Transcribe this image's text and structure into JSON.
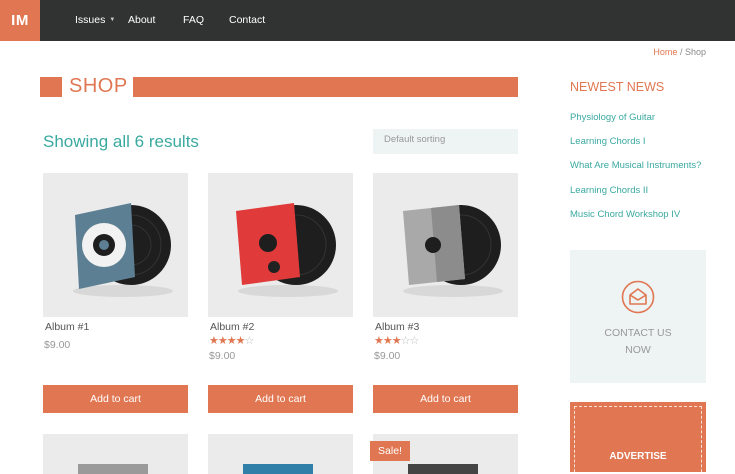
{
  "header": {
    "logo": "IM",
    "nav": [
      {
        "label": "Issues",
        "has_dropdown": true
      },
      {
        "label": "About"
      },
      {
        "label": "FAQ"
      },
      {
        "label": "Contact"
      }
    ]
  },
  "breadcrumb": {
    "home": "Home",
    "separator": "/",
    "current": "Shop"
  },
  "page_title": "SHOP",
  "results_text": "Showing all 6 results",
  "sorting": {
    "selected": "Default sorting"
  },
  "products": [
    {
      "name": "Album #1",
      "price": "$9.00",
      "rating": 0,
      "button": "Add to cart",
      "cover": "blue-grey"
    },
    {
      "name": "Album #2",
      "price": "$9.00",
      "rating": 4,
      "button": "Add to cart",
      "cover": "red"
    },
    {
      "name": "Album #3",
      "price": "$9.00",
      "rating": 3,
      "button": "Add to cart",
      "cover": "grey"
    }
  ],
  "second_row": [
    {
      "sale": false
    },
    {
      "sale": false
    },
    {
      "sale": true,
      "sale_label": "Sale!"
    }
  ],
  "sidebar": {
    "heading": "NEWEST NEWS",
    "news": [
      "Physiology of Guitar",
      "Learning Chords I",
      "What Are Musical Instruments?",
      "Learning Chords II",
      "Music Chord Workshop IV"
    ],
    "contact_line1": "CONTACT US",
    "contact_line2": "NOW",
    "ad_text": "ADVERTISE"
  },
  "colors": {
    "accent": "#e07752",
    "teal": "#3aa9a0",
    "topbar": "#313332"
  }
}
